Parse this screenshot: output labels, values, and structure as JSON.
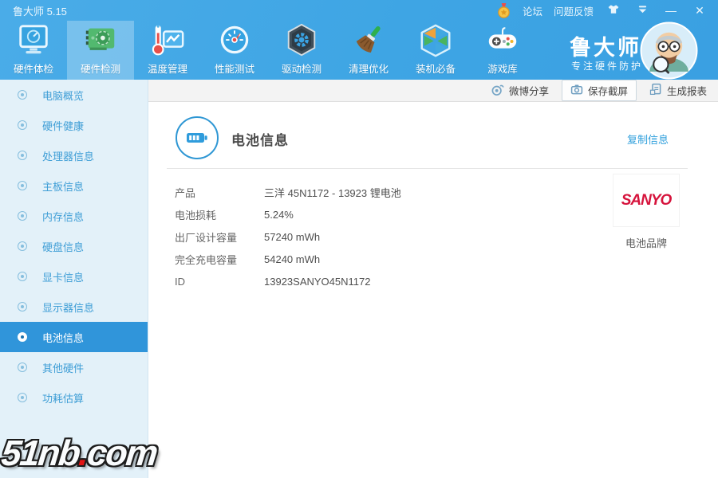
{
  "titlebar": {
    "title": "鲁大师 5.15",
    "forum_label": "论坛",
    "feedback_label": "问题反馈",
    "minimize_glyph": "—",
    "close_glyph": "✕"
  },
  "toolbar": {
    "tabs": [
      {
        "label": "硬件体检"
      },
      {
        "label": "硬件检测"
      },
      {
        "label": "温度管理"
      },
      {
        "label": "性能测试"
      },
      {
        "label": "驱动检测"
      },
      {
        "label": "清理优化"
      },
      {
        "label": "装机必备"
      },
      {
        "label": "游戏库"
      }
    ],
    "active_tab": "硬件检测",
    "brand_name": "鲁大师",
    "brand_slogan": "专注硬件防护"
  },
  "actionbar": {
    "weibo_label": "微博分享",
    "screenshot_label": "保存截屏",
    "report_label": "生成报表"
  },
  "sidebar": {
    "items": [
      {
        "label": "电脑概览"
      },
      {
        "label": "硬件健康"
      },
      {
        "label": "处理器信息"
      },
      {
        "label": "主板信息"
      },
      {
        "label": "内存信息"
      },
      {
        "label": "硬盘信息"
      },
      {
        "label": "显卡信息"
      },
      {
        "label": "显示器信息"
      },
      {
        "label": "电池信息"
      },
      {
        "label": "其他硬件"
      },
      {
        "label": "功耗估算"
      }
    ],
    "active_item": "电池信息"
  },
  "content": {
    "title": "电池信息",
    "copy_link_label": "复制信息",
    "rows": [
      {
        "label": "产品",
        "value": "三洋 45N1172 - 13923 锂电池"
      },
      {
        "label": "电池损耗",
        "value": "5.24%"
      },
      {
        "label": "出厂设计容量",
        "value": "57240 mWh"
      },
      {
        "label": "完全充电容量",
        "value": "54240 mWh"
      },
      {
        "label": "ID",
        "value": "13923SANYO45N1172"
      }
    ],
    "brand_logo_text": "SANYO",
    "brand_caption": "电池品牌"
  },
  "watermark": {
    "prefix": "51nb",
    "dot": ".",
    "suffix": "com"
  },
  "colors": {
    "titlebar_blue": "#3ea5e4",
    "sidebar_bg": "#e3f1f9",
    "active_item_blue": "#3095da",
    "link_blue": "#2f9fdc",
    "sanyo_red": "#d6133c"
  }
}
